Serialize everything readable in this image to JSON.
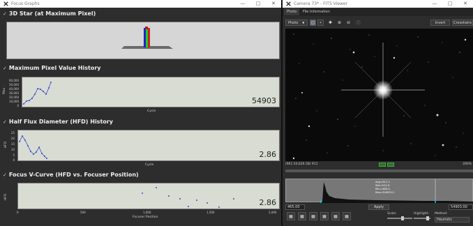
{
  "focus_window": {
    "title": "Focus Graphs",
    "sections": {
      "star3d": {
        "title": "3D Star (at Maximum Pixel)"
      },
      "maxpix": {
        "title": "Maximum Pixel Value History",
        "ylabel": "Max",
        "xlabel": "Cycle",
        "value": "54903",
        "yticks": [
          "60,000",
          "50,000",
          "40,000",
          "30,000",
          "20,000",
          "10,000",
          "0"
        ]
      },
      "hfd": {
        "title": "Half Flux Diameter (HFD) History",
        "ylabel": "HFD",
        "xlabel": "Cycle",
        "value": "2.86",
        "yticks": [
          "25",
          "20",
          "15",
          "10",
          "5",
          "0"
        ]
      },
      "vcurve": {
        "title": "Focus V-Curve (HFD vs. Focuser Position)",
        "ylabel": "HFD",
        "xlabel": "Focuser Position",
        "value": "2.86",
        "xticks": [
          "0",
          "500",
          "1,000",
          "1,500",
          "2,000"
        ]
      }
    }
  },
  "fits_window": {
    "title": "Camera 73* - FITS Viewer",
    "tabs": [
      "Photo",
      "File Information"
    ],
    "toolbar": {
      "mode_select": "Photo",
      "invert_label": "Invert",
      "crosshairs_label": "Crosshairs"
    },
    "status": {
      "coords": "(961.50,626.58) 911",
      "zoom": "200%"
    },
    "histogram": {
      "stats": [
        "Avg=611.1",
        "Std=512.9",
        "Min=465.0",
        "Max=54903.0"
      ],
      "low": "465.00",
      "high": "54903.00",
      "apply_label": "Apply",
      "scale_label": "Scale:",
      "highlight_label": "Highlight:",
      "method_label": "Method:",
      "method_value": "Heuristic"
    }
  }
}
